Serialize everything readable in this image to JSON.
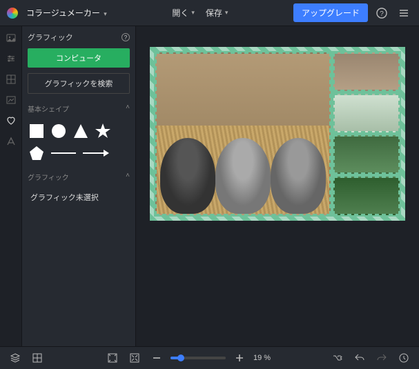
{
  "topbar": {
    "app_title": "コラージュメーカー",
    "open_label": "開く",
    "save_label": "保存",
    "upgrade_label": "アップグレード"
  },
  "panel": {
    "title": "グラフィック",
    "computer_btn": "コンピュータ",
    "search_btn": "グラフィックを検索",
    "shapes_header": "基本シェイプ",
    "graphic_header": "グラフィック",
    "no_selection": "グラフィック未選択"
  },
  "shapes": {
    "square": "square",
    "circle": "circle",
    "triangle": "triangle",
    "star": "star",
    "pentagon": "pentagon",
    "line": "line",
    "arrow": "arrow"
  },
  "bottombar": {
    "zoom_pct": "19 %"
  },
  "canvas": {
    "layout": "1-main-4-side",
    "border_style": "dashed-mint"
  }
}
